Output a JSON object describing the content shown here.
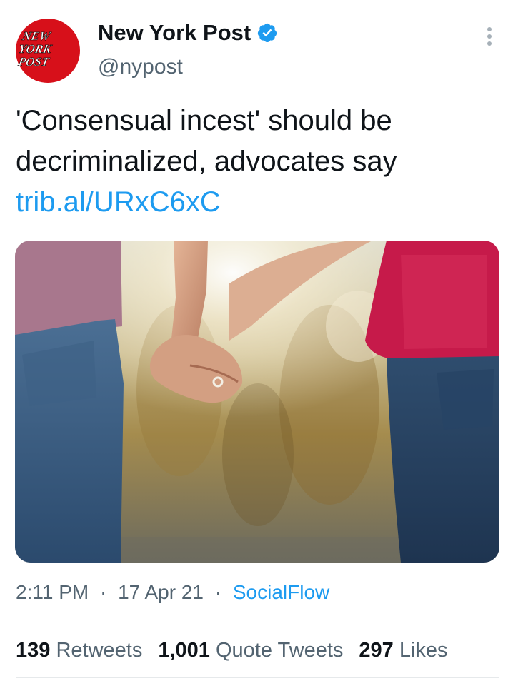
{
  "account": {
    "avatar_text": [
      "NEW",
      "YORK",
      "POST"
    ],
    "display_name": "New York Post",
    "handle": "@nypost",
    "verified_icon": "verified-badge-icon"
  },
  "tweet": {
    "text_lines": [
      "'Consensual incest' should be",
      "decriminalized, advocates say"
    ],
    "link": "trib.al/URxC6xC",
    "media": {
      "description_icon": "photo-holding-hands"
    }
  },
  "meta": {
    "time": "2:11 PM",
    "separator": "·",
    "date": "17 Apr 21",
    "source": "SocialFlow"
  },
  "stats": {
    "retweets": {
      "count": "139",
      "label": "Retweets"
    },
    "quote_tweets": {
      "count": "1,001",
      "label": "Quote Tweets"
    },
    "likes": {
      "count": "297",
      "label": "Likes"
    }
  },
  "colors": {
    "brand_red": "#d7101a",
    "link_blue": "#1d9bf0",
    "text_primary": "#0f1419",
    "text_secondary": "#536471",
    "divider": "#e6e9eb"
  }
}
